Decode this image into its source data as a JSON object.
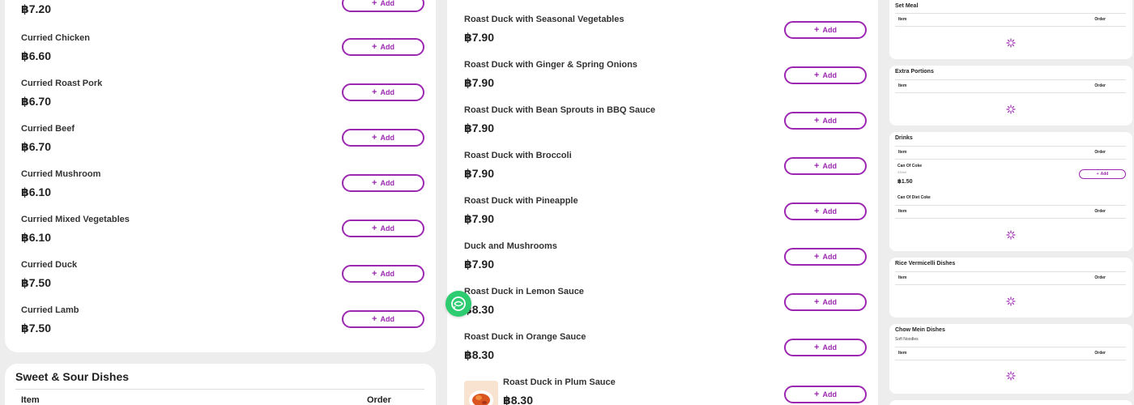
{
  "add_label": "Add",
  "accent_color": "#9c27b0",
  "curried_list": {
    "top_price": "฿7.20",
    "items": [
      {
        "name": "Curried Chicken",
        "price": "฿6.60"
      },
      {
        "name": "Curried Roast Pork",
        "price": "฿6.70"
      },
      {
        "name": "Curried Beef",
        "price": "฿6.70"
      },
      {
        "name": "Curried Mushroom",
        "price": "฿6.10"
      },
      {
        "name": "Curried Mixed Vegetables",
        "price": "฿6.10"
      },
      {
        "name": "Curried Duck",
        "price": "฿7.50"
      },
      {
        "name": "Curried Lamb",
        "price": "฿7.50"
      }
    ]
  },
  "sweet_sour_section": {
    "title": "Sweet & Sour Dishes",
    "col_item": "Item",
    "col_order": "Order"
  },
  "duck_list": {
    "items": [
      {
        "name": "Roast Duck with Seasonal Vegetables",
        "price": "฿7.90"
      },
      {
        "name": "Roast Duck with Ginger & Spring Onions",
        "price": "฿7.90"
      },
      {
        "name": "Roast Duck with Bean Sprouts in BBQ Sauce",
        "price": "฿7.90"
      },
      {
        "name": "Roast Duck with Broccoli",
        "price": "฿7.90"
      },
      {
        "name": "Roast Duck with Pineapple",
        "price": "฿7.90"
      },
      {
        "name": "Duck and Mushrooms",
        "price": "฿7.90"
      },
      {
        "name": "Roast Duck in Lemon Sauce",
        "price": "฿8.30"
      },
      {
        "name": "Roast Duck in Orange Sauce",
        "price": "฿8.30"
      },
      {
        "name": "Roast Duck in Plum Sauce",
        "price": "฿8.30"
      }
    ]
  },
  "sidebar": {
    "set_meal": {
      "title": "Set Meal",
      "col_item": "Item",
      "col_order": "Order"
    },
    "extra_portions": {
      "title": "Extra Portions",
      "col_item": "Item",
      "col_order": "Order"
    },
    "drinks": {
      "title": "Drinks",
      "col_item": "Item",
      "col_order": "Order",
      "item1_name": "Can Of Coke",
      "item1_sub": "330ml",
      "item1_price": "฿1.50",
      "item2_name": "Can Of Diet Coke"
    },
    "rice_vermicelli": {
      "title": "Rice Vermicelli Dishes",
      "col_item": "Item",
      "col_order": "Order"
    },
    "chow_mein": {
      "title": "Chow Mein Dishes",
      "subtitle": "Soft Noodles",
      "col_item": "Item",
      "col_order": "Order"
    }
  }
}
